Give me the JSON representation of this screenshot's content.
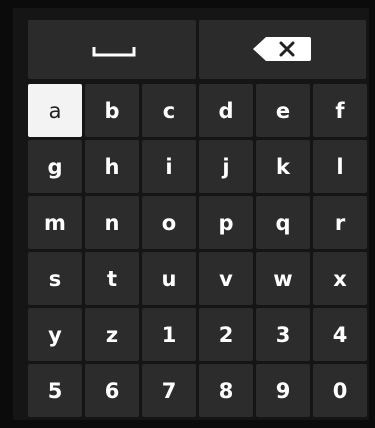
{
  "top_row": {
    "space_icon": "space-bar-icon",
    "backspace_icon": "backspace-icon"
  },
  "keys": [
    "a",
    "b",
    "c",
    "d",
    "e",
    "f",
    "g",
    "h",
    "i",
    "j",
    "k",
    "l",
    "m",
    "n",
    "o",
    "p",
    "q",
    "r",
    "s",
    "t",
    "u",
    "v",
    "w",
    "x",
    "y",
    "z",
    "1",
    "2",
    "3",
    "4",
    "5",
    "6",
    "7",
    "8",
    "9",
    "0"
  ],
  "selected_key": "a",
  "colors": {
    "key_background": "#2c2c2c",
    "selected_background": "#f3f3f3",
    "key_text": "#ffffff",
    "selected_text": "#222222"
  }
}
